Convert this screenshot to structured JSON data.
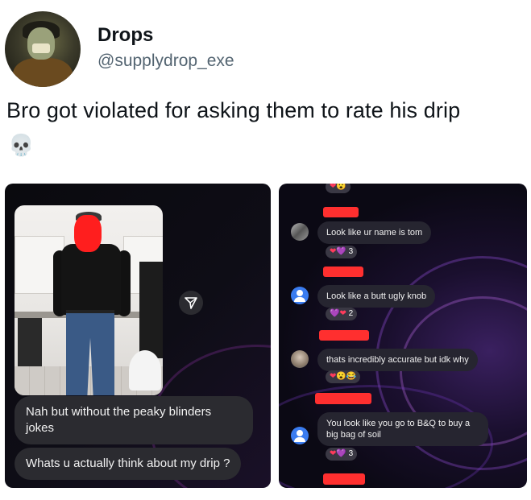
{
  "author": {
    "name": "Drops",
    "handle": "@supplydrop_exe"
  },
  "tweet": {
    "text": "Bro got violated for asking them to rate his drip",
    "emoji": "💀"
  },
  "left_panel": {
    "share_icon": "send-arrow-icon",
    "messages": [
      "Nah but without the peaky blinders jokes",
      "Whats u actually think about my drip ?"
    ]
  },
  "right_panel": {
    "comments": [
      {
        "avatar": "profile-photo",
        "text": "Look like ur name is tom",
        "reactions": "❤💜",
        "count": "3"
      },
      {
        "avatar": "default-user-icon",
        "text": "Look like a butt ugly knob",
        "reactions": "💜❤",
        "count": "2"
      },
      {
        "avatar": "profile-photo",
        "text": "thats incredibly accurate but idk why",
        "reactions": "❤😮😂",
        "count": ""
      },
      {
        "avatar": "default-user-icon",
        "text": "You look like you go to B&Q to buy a big bag of soil",
        "reactions": "❤💜",
        "count": "3"
      }
    ],
    "top_reactions": "❤😮"
  },
  "colors": {
    "redaction": "#ff2f2f",
    "handle": "#536471",
    "bubble": "#2b2b30"
  }
}
